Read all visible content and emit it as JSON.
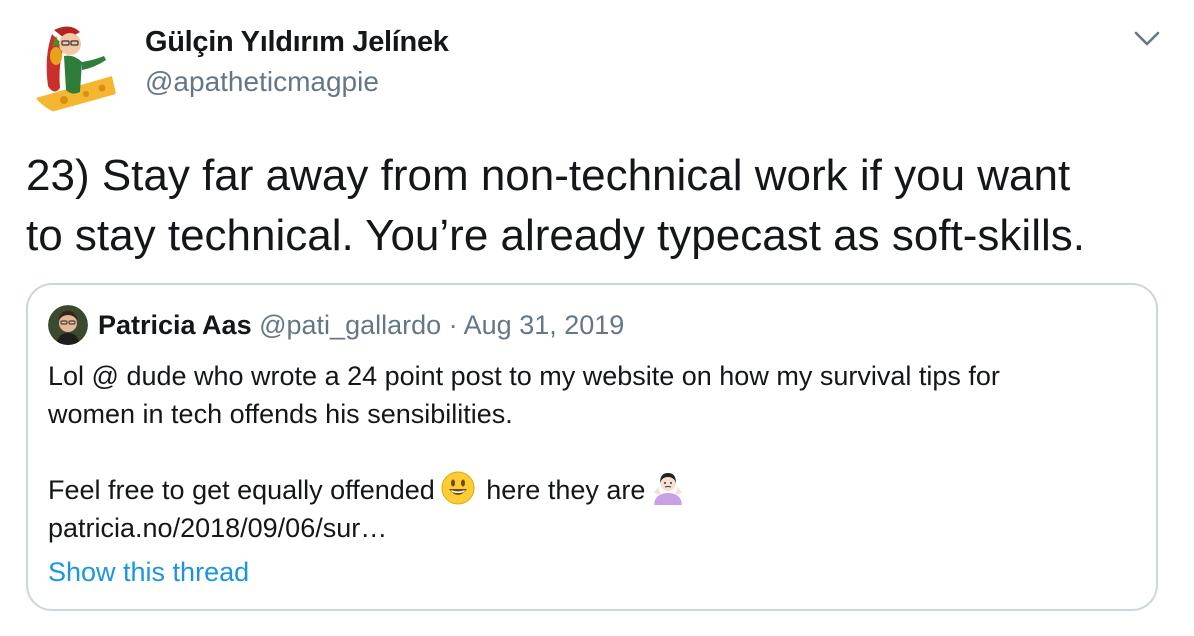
{
  "author": {
    "name": "Gülçin Yıldırım Jelínek",
    "handle": "@apatheticmagpie"
  },
  "tweet": {
    "line1": "23) Stay far away from non-technical work if you want",
    "line2": "to stay technical. You’re already typecast as soft-skills."
  },
  "quoted": {
    "name": "Patricia Aas",
    "handle": "@pati_gallardo",
    "dot": " · ",
    "date": "Aug 31, 2019",
    "line1": "Lol @ dude who wrote a 24 point post to my website on how my survival tips for",
    "line2": "women in tech offends his sensibilities.",
    "line3_a": "Feel free to get equally offended",
    "line3_b": " here they are",
    "link": "patricia.no/2018/09/06/sur…",
    "show_thread": "Show this thread"
  },
  "icons": {
    "caret": "chevron-down-icon",
    "emoji_1": "grinning-face-emoji",
    "emoji_2": "person-shrugging-emoji"
  },
  "colors": {
    "text": "#14171a",
    "secondary": "#657786",
    "link": "#1b95e0",
    "border": "#ccd6dd"
  }
}
